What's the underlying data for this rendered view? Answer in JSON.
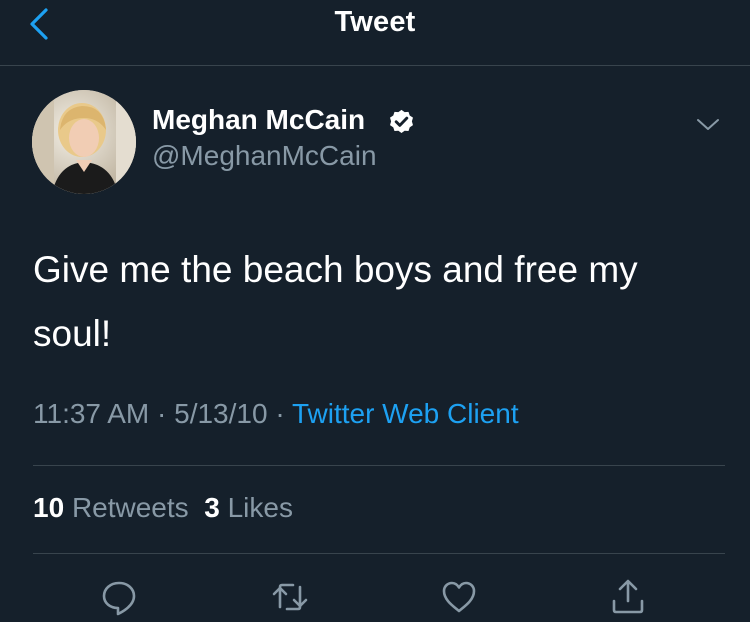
{
  "header": {
    "title": "Tweet",
    "back_icon": "chevron-left-icon"
  },
  "author": {
    "name": "Meghan McCain",
    "handle": "@MeghanMcCain",
    "verified": true
  },
  "tweet": {
    "line1": "Give me the beach boys and free my",
    "line2": "soul!"
  },
  "meta": {
    "time": "11:37 AM",
    "date": "5/13/10",
    "separator": " · ",
    "source": "Twitter Web Client"
  },
  "stats": {
    "retweets_count": "10",
    "retweets_label": "Retweets",
    "likes_count": "3",
    "likes_label": "Likes"
  },
  "actions": [
    "reply-icon",
    "retweet-icon",
    "like-icon",
    "share-icon"
  ],
  "colors": {
    "background": "#15202b",
    "text": "#ffffff",
    "secondary": "#8899a6",
    "accent": "#1da1f2",
    "divider": "#38444d"
  }
}
